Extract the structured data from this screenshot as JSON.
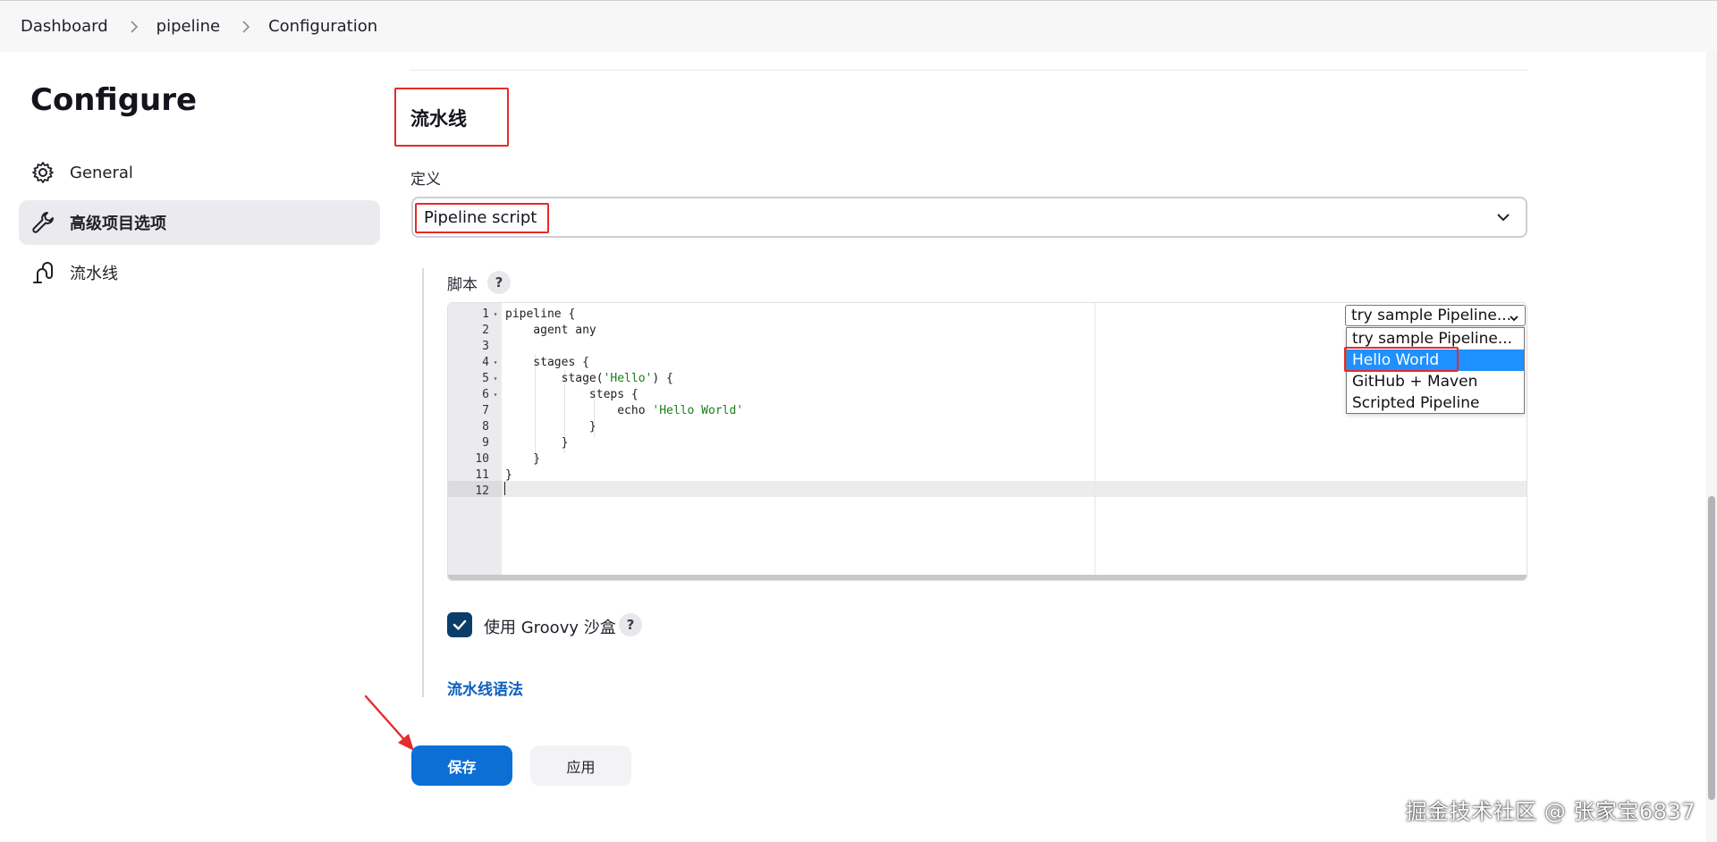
{
  "breadcrumb": {
    "items": [
      "Dashboard",
      "pipeline",
      "Configuration"
    ]
  },
  "page": {
    "title": "Configure"
  },
  "sidebar": {
    "items": [
      {
        "label": "General",
        "icon": "gear-icon",
        "active": false
      },
      {
        "label": "高级项目选项",
        "icon": "wrench-icon",
        "active": true
      },
      {
        "label": "流水线",
        "icon": "pipeline-icon",
        "active": false
      }
    ]
  },
  "section": {
    "title": "流水线",
    "definition_label": "定义",
    "definition_value": "Pipeline script",
    "script_label": "脚本",
    "help_symbol": "?"
  },
  "editor": {
    "lines": [
      {
        "n": "1",
        "fold": "▾",
        "code": "pipeline {"
      },
      {
        "n": "2",
        "fold": "",
        "code": "    agent any"
      },
      {
        "n": "3",
        "fold": "",
        "code": ""
      },
      {
        "n": "4",
        "fold": "▾",
        "code": "    stages {"
      },
      {
        "n": "5",
        "fold": "▾",
        "code": "        stage('Hello') {"
      },
      {
        "n": "6",
        "fold": "▾",
        "code": "            steps {"
      },
      {
        "n": "7",
        "fold": "",
        "code": "                echo 'Hello World'"
      },
      {
        "n": "8",
        "fold": "",
        "code": "            }"
      },
      {
        "n": "9",
        "fold": "",
        "code": "        }"
      },
      {
        "n": "10",
        "fold": "",
        "code": "    }"
      },
      {
        "n": "11",
        "fold": "",
        "code": "}"
      },
      {
        "n": "12",
        "fold": "",
        "code": ""
      }
    ]
  },
  "sample": {
    "selected": "try sample Pipeline...",
    "options": [
      "try sample Pipeline...",
      "Hello World",
      "GitHub + Maven",
      "Scripted Pipeline"
    ],
    "highlighted": "Hello World"
  },
  "sandbox": {
    "checked": true,
    "label": "使用 Groovy 沙盒"
  },
  "links": {
    "syntax": "流水线语法"
  },
  "buttons": {
    "save": "保存",
    "apply": "应用"
  },
  "watermark": {
    "brand": "掘金技术社区 @ 张家宝6837"
  },
  "colors": {
    "accent": "#0b6fd6",
    "annotation": "#e52b2b",
    "dropdown_highlight": "#1e90ff",
    "checkbox": "#0b3d6b"
  }
}
